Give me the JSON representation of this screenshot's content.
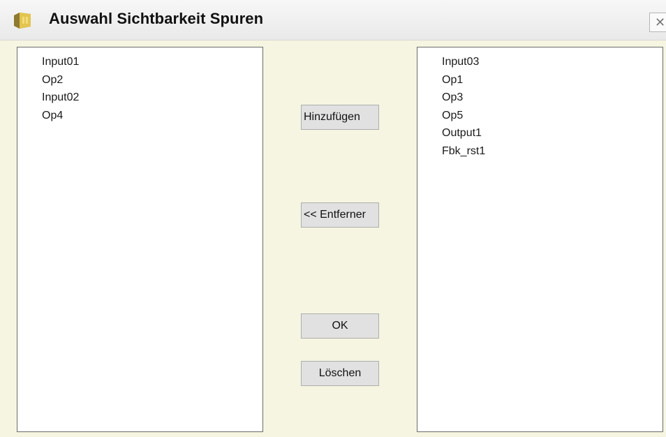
{
  "window": {
    "title": "Auswahl Sichtbarkeit Spuren",
    "close_symbol": "✕"
  },
  "icons": {
    "app": "folder-box-icon",
    "close": "close-icon"
  },
  "left_list": {
    "items": [
      "Input01",
      "Op2",
      "Input02",
      "Op4"
    ]
  },
  "right_list": {
    "items": [
      "Input03",
      "Op1",
      "Op3",
      "Op5",
      "Output1",
      "Fbk_rst1"
    ]
  },
  "buttons": {
    "add": "Hinzufügen",
    "remove": "<< Entferner",
    "ok": "OK",
    "delete": "Löschen"
  },
  "colors": {
    "client_background": "#f5f5e1",
    "button_background": "#e1e1e1"
  }
}
